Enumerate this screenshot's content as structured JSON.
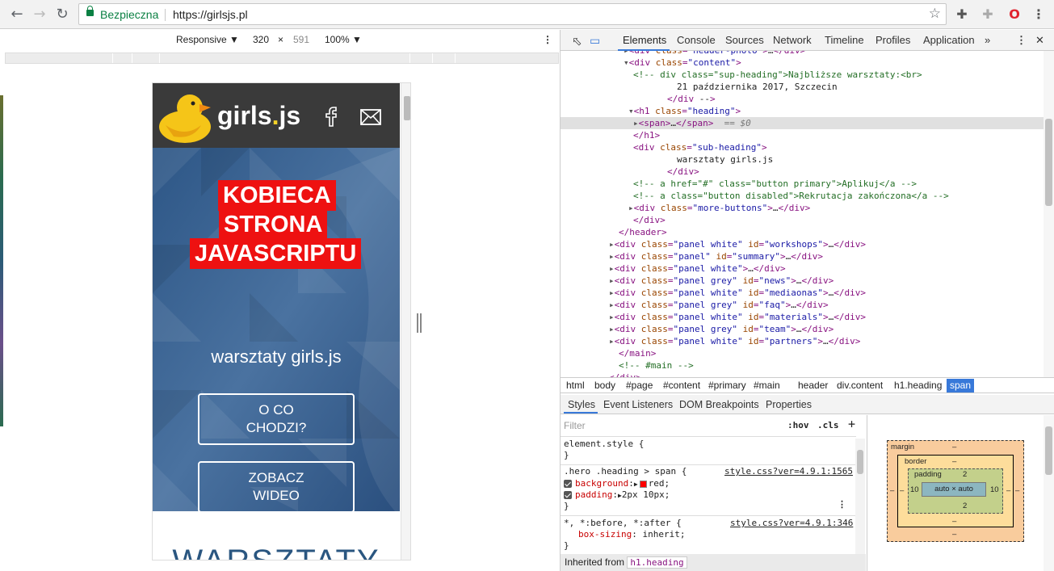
{
  "browser": {
    "secure_label": "Bezpieczna",
    "url": "https://girlsjs.pl",
    "back_icon": "arrow-left-icon",
    "forward_icon": "arrow-right-icon",
    "reload_icon": "reload-icon",
    "star_icon": "star-icon"
  },
  "device_toolbar": {
    "mode": "Responsive",
    "width": "320",
    "times": "×",
    "height": "591",
    "zoom": "100%"
  },
  "site": {
    "logo_text": "girls",
    "logo_dot": ".",
    "logo_suffix": "js",
    "heading_lines": [
      "KOBIECA",
      "STRONA",
      "JAVASCRIPTU"
    ],
    "subheading": "warsztaty girls.js",
    "button1_line1": "O CO",
    "button1_line2": "CHODZI?",
    "button2_line1": "ZOBACZ",
    "button2_line2": "WIDEO",
    "section_title": "WARSZTATY"
  },
  "devtools": {
    "tabs": [
      "Elements",
      "Console",
      "Sources",
      "Network",
      "Timeline",
      "Profiles",
      "Application"
    ],
    "more": "»",
    "elements_lines": [
      {
        "indent": 13,
        "html": "▸<div class=\"header-photo\">…</div>"
      },
      {
        "indent": 13,
        "html": "▾<div class=\"content\">"
      },
      {
        "indent": 15,
        "html": "<!-- div class=\"sup-heading\">Najbliższe warsztaty:<br>"
      },
      {
        "indent": 24,
        "html": "21 października 2017, Szczecin"
      },
      {
        "indent": 22,
        "html": "</div -->"
      },
      {
        "indent": 14,
        "html": "▾<h1 class=\"heading\">"
      },
      {
        "indent": 15,
        "html": "▸<span>…</span> == $0"
      },
      {
        "indent": 15,
        "html": "</h1>"
      },
      {
        "indent": 15,
        "html": "<div class=\"sub-heading\">"
      },
      {
        "indent": 24,
        "html": "warsztaty girls.js"
      },
      {
        "indent": 22,
        "html": "</div>"
      },
      {
        "indent": 15,
        "html": "<!-- a href=\"#\" class=\"button primary\">Aplikuj</a -->"
      },
      {
        "indent": 15,
        "html": "<!-- a class=\"button disabled\">Rekrutacja zakończona</a -->"
      },
      {
        "indent": 14,
        "html": "▸<div class=\"more-buttons\">…</div>"
      },
      {
        "indent": 15,
        "html": "</div>"
      },
      {
        "indent": 12,
        "html": "</header>"
      },
      {
        "indent": 10,
        "html": "▸<div class=\"panel white\" id=\"workshops\">…</div>"
      },
      {
        "indent": 10,
        "html": "▸<div class=\"panel\" id=\"summary\">…</div>"
      },
      {
        "indent": 10,
        "html": "▸<div class=\"panel white\">…</div>"
      },
      {
        "indent": 10,
        "html": "▸<div class=\"panel grey\" id=\"news\">…</div>"
      },
      {
        "indent": 10,
        "html": "▸<div class=\"panel white\" id=\"mediaonas\">…</div>"
      },
      {
        "indent": 10,
        "html": "▸<div class=\"panel grey\" id=\"faq\">…</div>"
      },
      {
        "indent": 10,
        "html": "▸<div class=\"panel white\" id=\"materials\">…</div>"
      },
      {
        "indent": 10,
        "html": "▸<div class=\"panel grey\" id=\"team\">…</div>"
      },
      {
        "indent": 10,
        "html": "▸<div class=\"panel white\" id=\"partners\">…</div>"
      },
      {
        "indent": 12,
        "html": "</main>"
      },
      {
        "indent": 12,
        "html": "<!-- #main -->"
      },
      {
        "indent": 10,
        "html": "</div>"
      }
    ],
    "breadcrumbs": [
      "html",
      "body",
      "#page",
      "#content",
      "#primary",
      "#main",
      "header",
      "div.content",
      "h1.heading",
      "span"
    ],
    "style_tabs": [
      "Styles",
      "Event Listeners",
      "DOM Breakpoints",
      "Properties"
    ],
    "filter_placeholder": "Filter",
    "hov": ":hov",
    "cls": ".cls",
    "plus": "+",
    "element_style": "element.style {",
    "close_brace": "}",
    "rule1_selector": ".hero .heading > span {",
    "rule1_link": "style.css?ver=4.9.1:1565",
    "rule1_prop1": "background",
    "rule1_val1": "red;",
    "rule1_prop2": "padding",
    "rule1_val2": "2px 10px;",
    "rule2_selector": "*, *:before, *:after {",
    "rule2_link": "style.css?ver=4.9.1:346",
    "rule2_prop": "box-sizing",
    "rule2_val": "inherit;",
    "inherited_label": "Inherited from",
    "inherited_selector": "h1.heading",
    "box": {
      "margin_label": "margin",
      "border_label": "border",
      "padding_label": "padding",
      "padding_top": "2",
      "padding_bottom": "2",
      "padding_left": "10",
      "padding_right": "10",
      "content": "auto × auto",
      "dash": "–"
    }
  }
}
